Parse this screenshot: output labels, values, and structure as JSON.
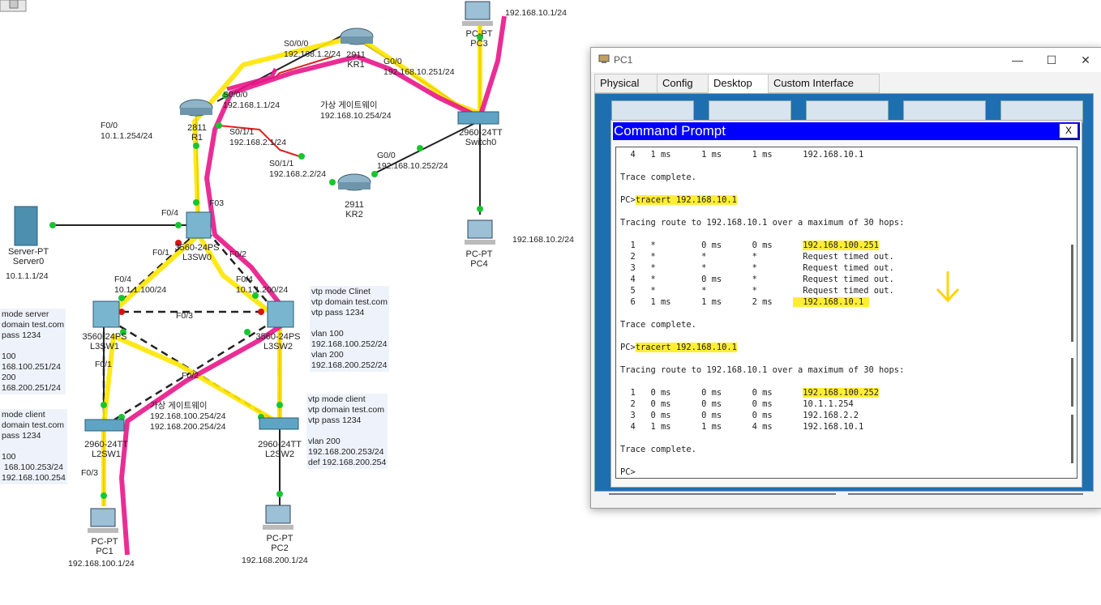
{
  "topology": {
    "devices": [
      {
        "id": "kr1",
        "type": "2911",
        "name": "KR1"
      },
      {
        "id": "r1",
        "type": "2811",
        "name": "R1"
      },
      {
        "id": "kr2",
        "type": "2911",
        "name": "KR2"
      },
      {
        "id": "switch0",
        "type": "2960-24TT",
        "name": "Switch0"
      },
      {
        "id": "pc3",
        "type": "PC-PT",
        "name": "PC3"
      },
      {
        "id": "pc4",
        "type": "PC-PT",
        "name": "PC4"
      },
      {
        "id": "server0",
        "type": "Server-PT",
        "name": "Server0"
      },
      {
        "id": "l3sw0",
        "type": "3560-24PS",
        "name": "L3SW0"
      },
      {
        "id": "l3sw1",
        "type": "3560-24PS",
        "name": "L3SW1"
      },
      {
        "id": "l3sw2",
        "type": "3560-24PS",
        "name": "L3SW2"
      },
      {
        "id": "l2sw1",
        "type": "2960-24TT",
        "name": "L2SW1"
      },
      {
        "id": "l2sw2",
        "type": "2960-24TT",
        "name": "L2SW2"
      },
      {
        "id": "pc1",
        "type": "PC-PT",
        "name": "PC1"
      },
      {
        "id": "pc2",
        "type": "PC-PT",
        "name": "PC2"
      }
    ],
    "labels": {
      "s000_kr1": "S0/0/0\n192.168.1.2/24",
      "kr1_g00": "G0/0\n192.168.10.251/24",
      "pc3_ip": "192.168.10.1/24",
      "s000_r1": "S0/0/0\n192.168.1.1/24",
      "vgw_10": "가상 게이트웨이\n192.168.10.254/24",
      "f00_r1": "F0/0\n10.1.1.254/24",
      "s011_r1": "S0/1/1\n192.168.2.1/24",
      "s011_kr2": "S0/1/1\n192.168.2.2/24",
      "kr2_g00": "G0/0\n192.168.10.252/24",
      "pc4_ip": "192.168.10.2/24",
      "f03": "F03",
      "f04": "F0/4",
      "server_ip": "10.1.1.1/24",
      "f01": "F0/1",
      "f02": "F0/2",
      "l3sw1_f04": "F0/4\n10.1.1.100/24",
      "l3sw2_f04": "F0/4\n10.1.1.200/24",
      "f03_mid": "F0/3",
      "f01_low": "F0/1",
      "f02_mid": "F0/2",
      "f03_low": "F0/3",
      "vgw_100": "가상 게이트웨이\n192.168.100.254/24\n192.168.200.254/24",
      "pc1_ip": "192.168.100.1/24",
      "pc2_ip": "192.168.200.1/24"
    },
    "notes": {
      "l3sw1": "mode server\ndomain test.com\npass 1234\n\n100\n168.100.251/24\n200\n168.200.251/24",
      "l2sw1": "mode client\ndomain test.com\npass 1234\n\n100\n 168.100.253/24\n192.168.100.254",
      "l3sw2": "vtp mode Clinet\nvtp domain test.com\nvtp pass 1234\n\nvlan 100\n192.168.100.252/24\nvlan 200\n192.168.200.252/24",
      "l2sw2": "vtp mode client\nvtp domain test.com\nvtp pass 1234\n\nvlan 200\n192.168.200.253/24\ndef 192.168.200.254"
    }
  },
  "window": {
    "title": "PC1",
    "tabs": [
      "Physical",
      "Config",
      "Desktop",
      "Custom Interface"
    ],
    "active_tab": "Desktop",
    "controls": {
      "minimize": "—",
      "maximize": "☐",
      "close": "✕"
    }
  },
  "command_prompt": {
    "title": "Command Prompt",
    "close": "X",
    "lines": [
      {
        "text": "  4   1 ms      1 ms      1 ms      192.168.10.1"
      },
      {
        "text": ""
      },
      {
        "text": "Trace complete."
      },
      {
        "text": ""
      },
      {
        "pre": "PC>",
        "hl": "tracert 192.168.10.1",
        "post": ""
      },
      {
        "text": ""
      },
      {
        "text": "Tracing route to 192.168.10.1 over a maximum of 30 hops:"
      },
      {
        "text": ""
      },
      {
        "pre": "  1   *         0 ms      0 ms      ",
        "hl": "192.168.100.251",
        "post": ""
      },
      {
        "text": "  2   *         *         *         Request timed out."
      },
      {
        "text": "  3   *         *         *         Request timed out."
      },
      {
        "text": "  4   *         0 ms      *         Request timed out."
      },
      {
        "text": "  5   *         *         *         Request timed out."
      },
      {
        "pre": "  6   1 ms      1 ms      2 ms    ",
        "hl": "  192.168.10.1 ",
        "post": ""
      },
      {
        "text": ""
      },
      {
        "text": "Trace complete."
      },
      {
        "text": ""
      },
      {
        "pre": "PC>",
        "hl": "tracert 192.168.10.1",
        "post": ""
      },
      {
        "text": ""
      },
      {
        "text": "Tracing route to 192.168.10.1 over a maximum of 30 hops:"
      },
      {
        "text": ""
      },
      {
        "pre": "  1   0 ms      0 ms      0 ms      ",
        "hl": "192.168.100.252",
        "post": ""
      },
      {
        "text": "  2   0 ms      0 ms      0 ms      10.1.1.254"
      },
      {
        "text": "  3   0 ms      0 ms      0 ms      192.168.2.2"
      },
      {
        "text": "  4   1 ms      1 ms      4 ms      192.168.10.1"
      },
      {
        "text": ""
      },
      {
        "text": "Trace complete."
      },
      {
        "text": ""
      },
      {
        "text": "PC>"
      }
    ],
    "annotation_arrow": "down-arrow-icon",
    "highlight_color": "#ffee33"
  }
}
